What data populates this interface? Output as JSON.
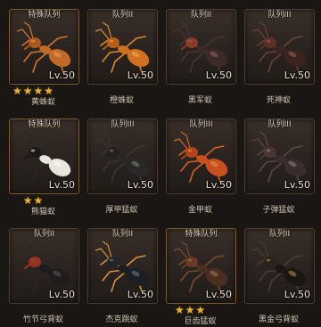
{
  "colors": {
    "card_bg": "#2a2320",
    "star": "#e8b23a",
    "text": "#e8e0d2",
    "background": "#1a1613"
  },
  "cards": [
    {
      "tier": "特殊队列",
      "level": "Lv.50",
      "name": "黄蛛蚁",
      "stars": "★★★★",
      "special": true,
      "ant": {
        "body": "#c06a2a",
        "head": "#a85a22",
        "legs": "#d07830",
        "sheen": "#f0a060"
      }
    },
    {
      "tier": "队列II",
      "level": "Lv.50",
      "name": "橙蛛蚁",
      "stars": "",
      "special": false,
      "ant": {
        "body": "#d07020",
        "head": "#b85e18",
        "legs": "#d88a30",
        "sheen": "#f5b060"
      }
    },
    {
      "tier": "队列II",
      "level": "Lv.50",
      "name": "黑军蚁",
      "stars": "",
      "special": false,
      "ant": {
        "body": "#3a2a28",
        "head": "#8a3a28",
        "legs": "#4a3430",
        "sheen": "#9a6a60"
      }
    },
    {
      "tier": "队列III",
      "level": "Lv.50",
      "name": "死神蚁",
      "stars": "",
      "special": false,
      "ant": {
        "body": "#3a2420",
        "head": "#5a3028",
        "legs": "#6a4036",
        "sheen": "#a06a5a"
      }
    },
    {
      "tier": "特殊队列",
      "level": "Lv.50",
      "name": "熊猫蚁",
      "stars": "★★",
      "special": true,
      "ant": {
        "body": "#e8e4de",
        "head": "#1a1818",
        "legs": "#2a2624",
        "sheen": "#ffffff"
      }
    },
    {
      "tier": "队列III",
      "level": "Lv.50",
      "name": "厚甲猛蚁",
      "stars": "",
      "special": false,
      "ant": {
        "body": "#2a2826",
        "head": "#222020",
        "legs": "#3a3634",
        "sheen": "#8a8884"
      }
    },
    {
      "tier": "队列III",
      "level": "Lv.50",
      "name": "金甲蚁",
      "stars": "",
      "special": false,
      "ant": {
        "body": "#c8501e",
        "head": "#b04418",
        "legs": "#d06028",
        "sheen": "#f0905a"
      }
    },
    {
      "tier": "队列III",
      "level": "Lv.50",
      "name": "子弹猛蚁",
      "stars": "",
      "special": false,
      "ant": {
        "body": "#3a2e2c",
        "head": "#4a3634",
        "legs": "#5a4644",
        "sheen": "#9a8884"
      }
    },
    {
      "tier": "队列II",
      "level": "Lv.50",
      "name": "竹节弓背蚁",
      "stars": "",
      "special": false,
      "ant": {
        "body": "#1e1c1c",
        "head": "#9a3020",
        "legs": "#2a2424",
        "sheen": "#6a6060"
      }
    },
    {
      "tier": "队列II",
      "level": "Lv.50",
      "name": "杰克跳蚁",
      "stars": "",
      "special": false,
      "ant": {
        "body": "#1c1e24",
        "head": "#22242a",
        "legs": "#d89040",
        "sheen": "#7a8aa0"
      }
    },
    {
      "tier": "特殊队列",
      "level": "Lv.50",
      "name": "巨齿猛蚁",
      "stars": "★★★",
      "special": true,
      "ant": {
        "body": "#4a2e22",
        "head": "#6a3a26",
        "legs": "#7a4a30",
        "sheen": "#b07a5a"
      }
    },
    {
      "tier": "队列II",
      "level": "Lv.50",
      "name": "黑金弓背蚁",
      "stars": "",
      "special": false,
      "ant": {
        "body": "#1a1614",
        "head": "#2a2220",
        "legs": "#4a3e34",
        "sheen": "#c8a040"
      }
    }
  ]
}
